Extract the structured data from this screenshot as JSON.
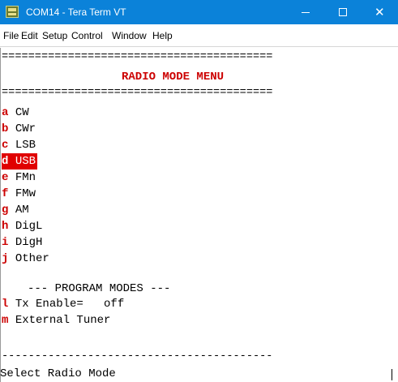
{
  "window": {
    "title": "COM14 - Tera Term VT",
    "controls": {
      "minimize": "minimize",
      "maximize": "maximize",
      "close": "close"
    }
  },
  "menu": [
    "File",
    "Edit",
    "Setup",
    "Control",
    "Window",
    "Help"
  ],
  "terminal": {
    "separator_top": "=========================================",
    "heading": "RADIO MODE MENU",
    "separator_mid": "=========================================",
    "modes": [
      {
        "key": "a",
        "label": "CW",
        "selected": false
      },
      {
        "key": "b",
        "label": "CWr",
        "selected": false
      },
      {
        "key": "c",
        "label": "LSB",
        "selected": false
      },
      {
        "key": "d",
        "label": "USB",
        "selected": true
      },
      {
        "key": "e",
        "label": "FMn",
        "selected": false
      },
      {
        "key": "f",
        "label": "FMw",
        "selected": false
      },
      {
        "key": "g",
        "label": "AM",
        "selected": false
      },
      {
        "key": "h",
        "label": "DigL",
        "selected": false
      },
      {
        "key": "i",
        "label": "DigH",
        "selected": false
      },
      {
        "key": "j",
        "label": "Other",
        "selected": false
      }
    ],
    "program_header": "--- PROGRAM MODES ---",
    "program_items": [
      {
        "key": "l",
        "label": "Tx Enable=   off"
      },
      {
        "key": "m",
        "label": "External Tuner"
      }
    ],
    "separator_bottom": "-----------------------------------------",
    "prompt": "Select Radio Mode"
  },
  "colors": {
    "titlebar": "#0b82d9",
    "key": "#cc0000",
    "selection": "#e00000"
  }
}
